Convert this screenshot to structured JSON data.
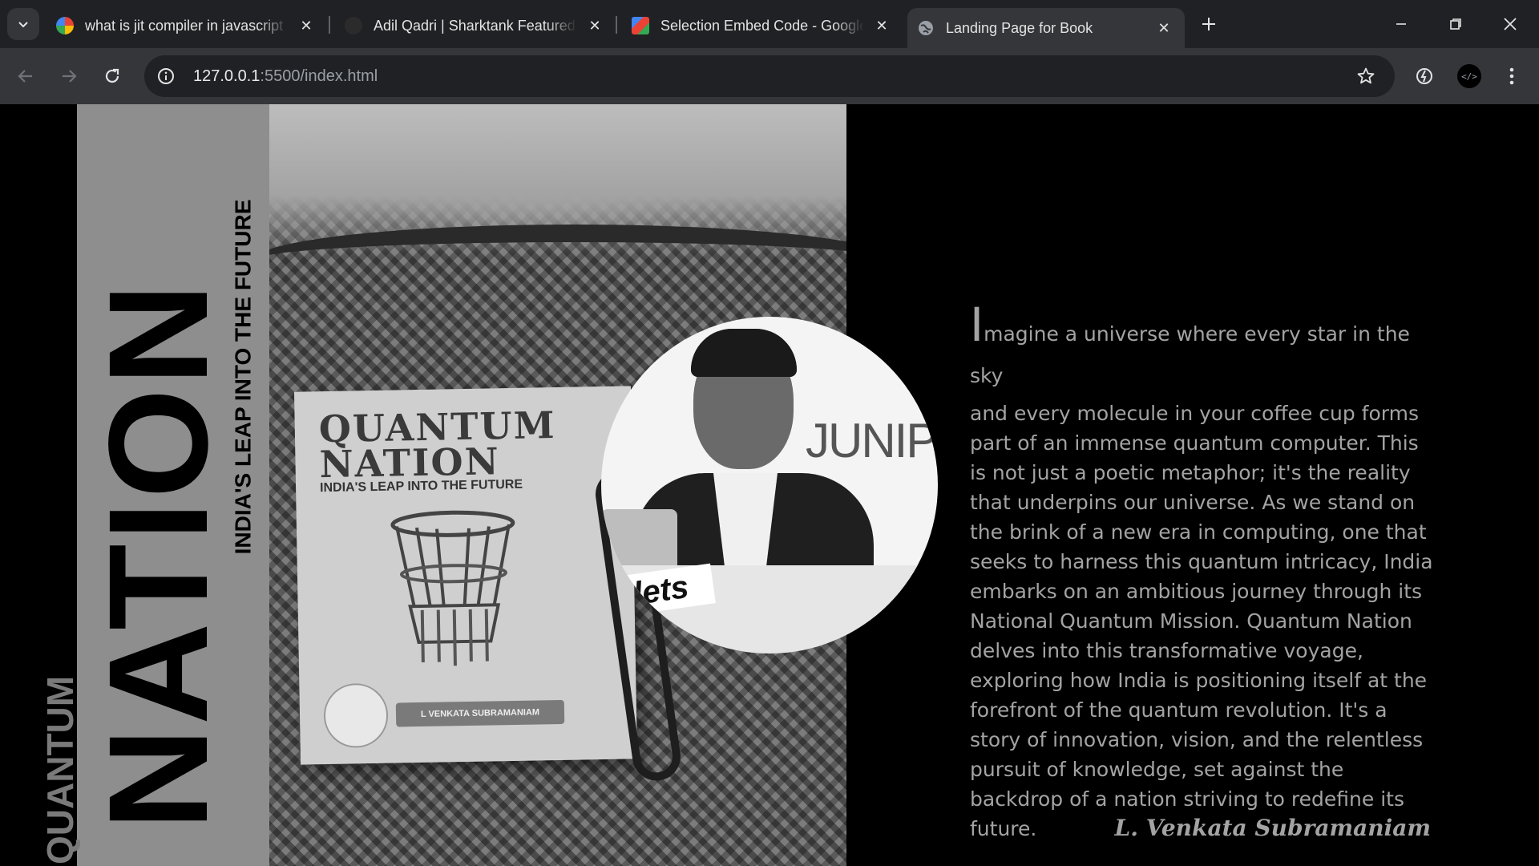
{
  "browser": {
    "tabs": [
      {
        "title": "what is jit compiler in javascript",
        "favicon": "google-icon",
        "active": false
      },
      {
        "title": "Adil Qadri | Sharktank Featured",
        "favicon": "profile-favicon",
        "active": false
      },
      {
        "title": "Selection Embed Code - Google",
        "favicon": "google-icon",
        "active": false
      },
      {
        "title": "Landing Page for Book",
        "favicon": "globe-icon",
        "active": true
      }
    ],
    "url_host": "127.0.0.1",
    "url_path": ":5500/index.html"
  },
  "page": {
    "title_small": "QUANTUM",
    "title_big": "NATION",
    "tagline": "INDIA'S LEAP INTO THE FUTURE",
    "book": {
      "cover_title_line1": "QUANTUM",
      "cover_title_line2": "NATION",
      "cover_subtitle": "INDIA'S LEAP INTO THE FUTURE",
      "cover_author": "L VENKATA SUBRAMANIAM"
    },
    "portrait": {
      "brand_text": "JUNIPE",
      "sign_text": "lets"
    },
    "description_drop_cap": "I",
    "description_first_line": "magine a universe where every star in the sky",
    "description_rest": "and every molecule in your coffee cup forms part of an immense quantum computer. This is not just a poetic metaphor; it's the reality that underpins our universe. As we stand on the brink of a new era in computing, one that seeks to harness this quantum intricacy, India embarks on an ambitious journey through its National Quantum Mission. Quantum Nation delves into this transformative voyage, exploring how India is positioning itself at the forefront of the quantum revolution. It's a story of innovation, vision, and the relentless pursuit of knowledge, set against the backdrop of a nation striving to redefine its future.",
    "author_signature": "L. Venkata Subramaniam"
  },
  "colors": {
    "chrome_dark": "#202124",
    "chrome_mid": "#35363a",
    "strip_gray": "#8e8e8e",
    "text_gray": "#a3a3a3"
  }
}
